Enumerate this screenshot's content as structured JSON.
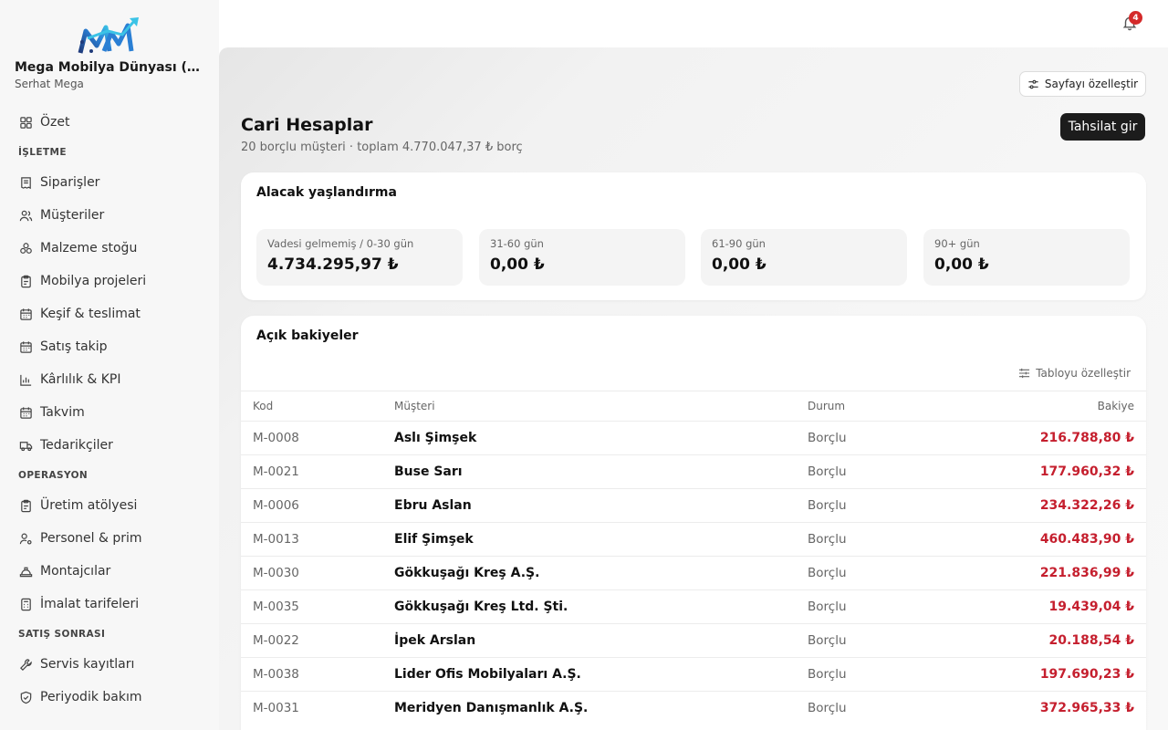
{
  "app": {
    "org_name": "Mega Mobilya Dünyası (De...",
    "user_name": "Serhat Mega",
    "notification_count": "4"
  },
  "nav": {
    "summary": "Özet",
    "sections": [
      {
        "title": "İŞLETME",
        "items": [
          {
            "label": "Siparişler",
            "icon": "receipt-icon"
          },
          {
            "label": "Müşteriler",
            "icon": "users-icon"
          },
          {
            "label": "Malzeme stoğu",
            "icon": "boxes-icon"
          },
          {
            "label": "Mobilya projeleri",
            "icon": "clipboard-icon"
          },
          {
            "label": "Keşif & teslimat",
            "icon": "calendar-icon"
          },
          {
            "label": "Satış takip",
            "icon": "calendar-icon"
          },
          {
            "label": "Kârlılık & KPI",
            "icon": "bar-chart-icon"
          },
          {
            "label": "Takvim",
            "icon": "calendar-icon"
          },
          {
            "label": "Tedarikçiler",
            "icon": "truck-icon"
          }
        ]
      },
      {
        "title": "OPERASYON",
        "items": [
          {
            "label": "Üretim atölyesi",
            "icon": "clipboard-icon"
          },
          {
            "label": "Personel & prim",
            "icon": "user-cog-icon"
          },
          {
            "label": "Montajcılar",
            "icon": "hard-hat-icon"
          },
          {
            "label": "İmalat tarifeleri",
            "icon": "calculator-icon"
          }
        ]
      },
      {
        "title": "SATIŞ SONRASI",
        "items": [
          {
            "label": "Servis kayıtları",
            "icon": "wrench-icon"
          },
          {
            "label": "Periyodik bakım",
            "icon": "shield-check-icon"
          }
        ]
      }
    ]
  },
  "header": {
    "customize_label": "Sayfayı özelleştir",
    "title": "Cari Hesaplar",
    "subtitle": "20 borçlu müşteri · toplam 4.770.047,37 ₺ borç",
    "primary_action": "Tahsilat gir"
  },
  "aging": {
    "title": "Alacak yaşlandırma",
    "buckets": [
      {
        "label": "Vadesi gelmemiş / 0-30 gün",
        "value": "4.734.295,97 ₺"
      },
      {
        "label": "31-60 gün",
        "value": "0,00 ₺"
      },
      {
        "label": "61-90 gün",
        "value": "0,00 ₺"
      },
      {
        "label": "90+ gün",
        "value": "0,00 ₺"
      }
    ]
  },
  "balances": {
    "title": "Açık bakiyeler",
    "customize_label": "Tabloyu özelleştir",
    "columns": {
      "code": "Kod",
      "customer": "Müşteri",
      "status": "Durum",
      "balance": "Bakiye"
    },
    "rows": [
      {
        "code": "M-0008",
        "customer": "Aslı Şimşek",
        "status": "Borçlu",
        "balance": "216.788,80 ₺"
      },
      {
        "code": "M-0021",
        "customer": "Buse Sarı",
        "status": "Borçlu",
        "balance": "177.960,32 ₺"
      },
      {
        "code": "M-0006",
        "customer": "Ebru Aslan",
        "status": "Borçlu",
        "balance": "234.322,26 ₺"
      },
      {
        "code": "M-0013",
        "customer": "Elif Şimşek",
        "status": "Borçlu",
        "balance": "460.483,90 ₺"
      },
      {
        "code": "M-0030",
        "customer": "Gökkuşağı Kreş A.Ş.",
        "status": "Borçlu",
        "balance": "221.836,99 ₺"
      },
      {
        "code": "M-0035",
        "customer": "Gökkuşağı Kreş Ltd. Şti.",
        "status": "Borçlu",
        "balance": "19.439,04 ₺"
      },
      {
        "code": "M-0022",
        "customer": "İpek Arslan",
        "status": "Borçlu",
        "balance": "20.188,54 ₺"
      },
      {
        "code": "M-0038",
        "customer": "Lider Ofis Mobilyaları A.Ş.",
        "status": "Borçlu",
        "balance": "197.690,23 ₺"
      },
      {
        "code": "M-0031",
        "customer": "Meridyen Danışmanlık A.Ş.",
        "status": "Borçlu",
        "balance": "372.965,33 ₺"
      }
    ]
  },
  "colors": {
    "accent": "#1c1c1c",
    "debt": "#c51f2e",
    "badge": "#d42a2a"
  }
}
